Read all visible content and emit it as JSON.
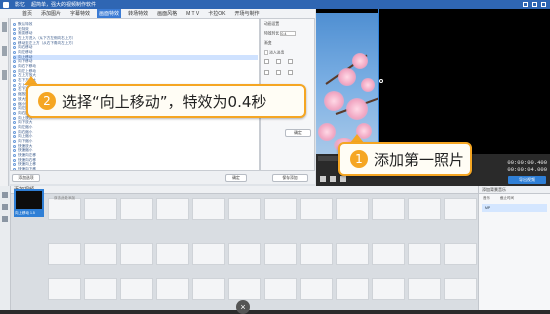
{
  "window": {
    "app_name": "影忆",
    "title": "超简单，强大的视频制作软件"
  },
  "menu": {
    "tabs": [
      "首页",
      "添加图片",
      "字幕特效",
      "画面特效",
      "转场特效",
      "画面风格",
      "M T V",
      "卡拉OK",
      "开场与制作"
    ],
    "active_index": 3
  },
  "effects": {
    "items": [
      "默认特效",
      "无特效",
      "渐变移动",
      "左上方进入（从下方左侧向右上方）",
      "移动至左上方（从右下角向左上方）",
      "向右移动",
      "向左移动",
      "向上移动",
      "向下移动",
      "向右下移动",
      "向左上移动",
      "左上方放大",
      "右下方放大",
      "左上方缩小",
      "右下方缩小",
      "缩放效果",
      "放大效果",
      "缩小效果",
      "向左放大",
      "向右放大",
      "向上放大",
      "向下放大",
      "向左缩小",
      "向右缩小",
      "向上缩小",
      "向下缩小",
      "快速放大",
      "快速缩小",
      "快速向左移",
      "快速向右移",
      "快速向上移",
      "快速向下移"
    ],
    "selected_index": 7
  },
  "settings": {
    "title": "动画设置",
    "duration_label": "特效时长",
    "duration_value": "0.4",
    "fade_label": "渐变",
    "fade_in": "淡入淡出",
    "bottom_button": "确定"
  },
  "bottom": {
    "add_button": "添加选项",
    "confirm_button": "确定",
    "save_button": "保存添加"
  },
  "playback": {
    "time_current": "00:00:00.400",
    "time_total": "00:00:04.000",
    "export_button": "导出视频"
  },
  "timeline": {
    "toolbar_label": "添加视频",
    "clip_label": "向上移动 1.5",
    "empty_hint": "双击此处添加",
    "slot_count": 20
  },
  "music": {
    "header": "添加背景音乐",
    "col1": "音乐",
    "col2": "截止时间",
    "selected_item": "MP"
  },
  "callouts": [
    {
      "number": "1",
      "text": "添加第一照片"
    },
    {
      "number": "2",
      "text": "选择“向上移动”，特效为0.4秒"
    }
  ]
}
